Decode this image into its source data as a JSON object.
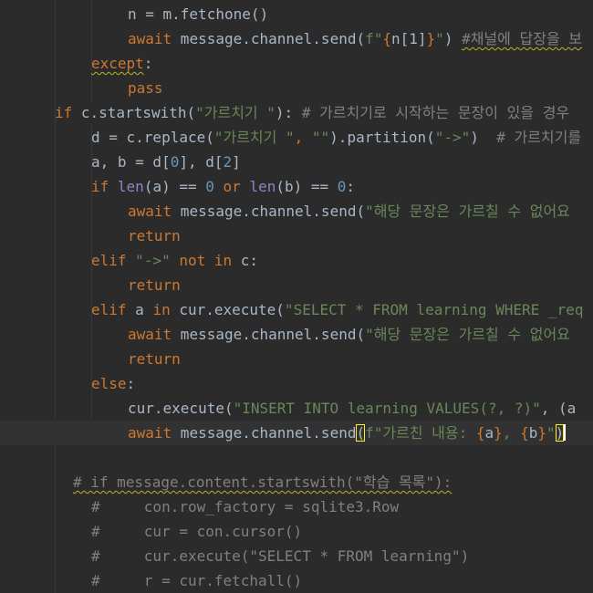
{
  "editor": {
    "current_line": 17,
    "lines": [
      {
        "indent": 140,
        "tokens": [
          {
            "t": "n = m.fetchone()",
            "c": ""
          }
        ]
      },
      {
        "indent": 140,
        "tokens": [
          {
            "t": "await",
            "c": "kw"
          },
          {
            "t": " message.channel.send(",
            "c": ""
          },
          {
            "t": "f\"",
            "c": "str"
          },
          {
            "t": "{",
            "c": "brace"
          },
          {
            "t": "n[1]",
            "c": ""
          },
          {
            "t": "}",
            "c": "brace"
          },
          {
            "t": "\"",
            "c": "str"
          },
          {
            "t": ") ",
            "c": ""
          },
          {
            "t": "#채널에 답장을 보",
            "c": "cmt squig"
          }
        ]
      },
      {
        "indent": 100,
        "tokens": [
          {
            "t": "except",
            "c": "kw squig"
          },
          {
            "t": ":",
            "c": ""
          }
        ]
      },
      {
        "indent": 140,
        "tokens": [
          {
            "t": "pass",
            "c": "kw"
          }
        ]
      },
      {
        "indent": 60,
        "tokens": [
          {
            "t": "if",
            "c": "kw"
          },
          {
            "t": " c.startswith(",
            "c": ""
          },
          {
            "t": "\"가르치기 \"",
            "c": "str"
          },
          {
            "t": "): ",
            "c": ""
          },
          {
            "t": "# 가르치기로 시작하는 문장이 있을 경우",
            "c": "cmt"
          }
        ]
      },
      {
        "indent": 100,
        "tokens": [
          {
            "t": "d = c.replace(",
            "c": ""
          },
          {
            "t": "\"가르치기 \"",
            "c": "str"
          },
          {
            "t": ", ",
            "c": "kw"
          },
          {
            "t": "\"\"",
            "c": "str"
          },
          {
            "t": ").partition(",
            "c": ""
          },
          {
            "t": "\"->\"",
            "c": "str"
          },
          {
            "t": ")  ",
            "c": ""
          },
          {
            "t": "# 가르치기를",
            "c": "cmt"
          }
        ]
      },
      {
        "indent": 100,
        "tokens": [
          {
            "t": "a, b = d[",
            "c": ""
          },
          {
            "t": "0",
            "c": "num"
          },
          {
            "t": "], d[",
            "c": ""
          },
          {
            "t": "2",
            "c": "num"
          },
          {
            "t": "]",
            "c": ""
          }
        ]
      },
      {
        "indent": 100,
        "tokens": [
          {
            "t": "if",
            "c": "kw"
          },
          {
            "t": " ",
            "c": ""
          },
          {
            "t": "len",
            "c": "fn"
          },
          {
            "t": "(a) == ",
            "c": ""
          },
          {
            "t": "0",
            "c": "num"
          },
          {
            "t": " ",
            "c": ""
          },
          {
            "t": "or",
            "c": "kw"
          },
          {
            "t": " ",
            "c": ""
          },
          {
            "t": "len",
            "c": "fn"
          },
          {
            "t": "(b) == ",
            "c": ""
          },
          {
            "t": "0",
            "c": "num"
          },
          {
            "t": ":",
            "c": ""
          }
        ]
      },
      {
        "indent": 140,
        "tokens": [
          {
            "t": "await",
            "c": "kw"
          },
          {
            "t": " message.channel.send(",
            "c": ""
          },
          {
            "t": "\"해당 문장은 가르칠 수 없어요",
            "c": "str"
          }
        ]
      },
      {
        "indent": 140,
        "tokens": [
          {
            "t": "return",
            "c": "kw"
          }
        ]
      },
      {
        "indent": 100,
        "tokens": [
          {
            "t": "elif",
            "c": "kw"
          },
          {
            "t": " ",
            "c": ""
          },
          {
            "t": "\"->\"",
            "c": "str"
          },
          {
            "t": " ",
            "c": ""
          },
          {
            "t": "not in",
            "c": "kw"
          },
          {
            "t": " c:",
            "c": ""
          }
        ]
      },
      {
        "indent": 140,
        "tokens": [
          {
            "t": "return",
            "c": "kw"
          }
        ]
      },
      {
        "indent": 100,
        "tokens": [
          {
            "t": "elif",
            "c": "kw"
          },
          {
            "t": " a ",
            "c": ""
          },
          {
            "t": "in",
            "c": "kw"
          },
          {
            "t": " cur.execute(",
            "c": ""
          },
          {
            "t": "\"SELECT * FROM learning WHERE _req",
            "c": "str"
          }
        ]
      },
      {
        "indent": 140,
        "tokens": [
          {
            "t": "await",
            "c": "kw"
          },
          {
            "t": " message.channel.send(",
            "c": ""
          },
          {
            "t": "\"해당 문장은 가르칠 수 없어요",
            "c": "str"
          }
        ]
      },
      {
        "indent": 140,
        "tokens": [
          {
            "t": "return",
            "c": "kw"
          }
        ]
      },
      {
        "indent": 100,
        "tokens": [
          {
            "t": "else",
            "c": "kw"
          },
          {
            "t": ":",
            "c": ""
          }
        ]
      },
      {
        "indent": 140,
        "tokens": [
          {
            "t": "cur.execute(",
            "c": ""
          },
          {
            "t": "\"INSERT INTO learning VALUES(?, ?)\"",
            "c": "str"
          },
          {
            "t": ", (a",
            "c": ""
          }
        ]
      },
      {
        "indent": 140,
        "tokens": [
          {
            "t": "await",
            "c": "kw"
          },
          {
            "t": " message.channel.send",
            "c": ""
          },
          {
            "t": "(",
            "c": "caret-match"
          },
          {
            "t": "f\"가르친 내용: ",
            "c": "str"
          },
          {
            "t": "{",
            "c": "brace"
          },
          {
            "t": "a",
            "c": ""
          },
          {
            "t": "}",
            "c": "brace"
          },
          {
            "t": ", ",
            "c": "str"
          },
          {
            "t": "{",
            "c": "brace"
          },
          {
            "t": "b",
            "c": ""
          },
          {
            "t": "}",
            "c": "brace"
          },
          {
            "t": "\"",
            "c": "str"
          },
          {
            "t": ")",
            "c": "caret-match"
          },
          {
            "t": "",
            "c": "caret"
          }
        ]
      },
      {
        "indent": 0,
        "tokens": []
      },
      {
        "indent": 80,
        "tokens": [
          {
            "t": "# if message.content.startswith(\"학습 목록\"):",
            "c": "cmt squig"
          }
        ]
      },
      {
        "indent": 100,
        "tokens": [
          {
            "t": "#     con.row_factory = sqlite3.Row",
            "c": "cmt"
          }
        ]
      },
      {
        "indent": 100,
        "tokens": [
          {
            "t": "#     cur = con.cursor()",
            "c": "cmt"
          }
        ]
      },
      {
        "indent": 100,
        "tokens": [
          {
            "t": "#     cur.execute(\"SELECT * FROM learning\")",
            "c": "cmt"
          }
        ]
      },
      {
        "indent": 100,
        "tokens": [
          {
            "t": "#     r = cur.fetchall()",
            "c": "cmt"
          }
        ]
      }
    ]
  }
}
